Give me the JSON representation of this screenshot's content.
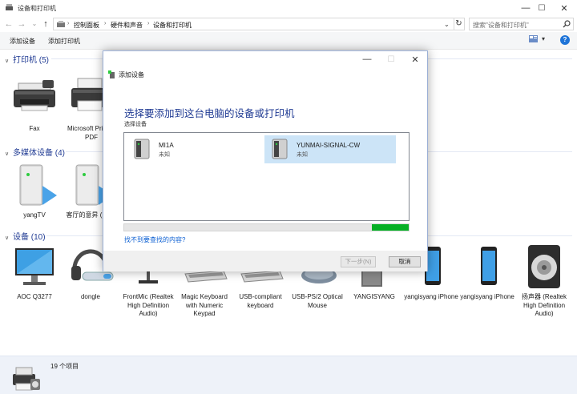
{
  "window": {
    "title": "设备和打印机",
    "controls": {
      "minimize": "—",
      "maximize": "☐",
      "close": "✕"
    }
  },
  "nav": {
    "back": "←",
    "forward": "→",
    "recent": "⌄",
    "up": "↑",
    "breadcrumb": [
      "控制面板",
      "硬件和声音",
      "设备和打印机"
    ],
    "separator": "›",
    "dropdown": "⌄",
    "refresh": "↻",
    "search_placeholder": "搜索\"设备和打印机\""
  },
  "toolbar": {
    "add_device": "添加设备",
    "add_printer": "添加打印机",
    "view_dropdown": "▾",
    "help": "?"
  },
  "sections": {
    "printers": {
      "title": "打印机 (5)",
      "items": [
        {
          "label": "Fax",
          "icon": "fax-icon"
        },
        {
          "label": "Microsoft Print to PDF",
          "icon": "printer-icon"
        }
      ]
    },
    "multimedia": {
      "title": "多媒体设备 (4)",
      "items": [
        {
          "label": "yangTV",
          "icon": "media-server-icon"
        },
        {
          "label": "客厅的意昇 (104)",
          "icon": "media-server-icon"
        }
      ]
    },
    "devices": {
      "title": "设备 (10)",
      "items": [
        {
          "label": "AOC Q3277",
          "icon": "monitor-icon"
        },
        {
          "label": "dongle",
          "icon": "headset-icon"
        },
        {
          "label": "FrontMic (Realtek High Definition Audio)",
          "icon": "microphone-icon"
        },
        {
          "label": "Magic Keyboard with Numeric Keypad",
          "icon": "keyboard-icon"
        },
        {
          "label": "USB-compliant keyboard",
          "icon": "keyboard-icon"
        },
        {
          "label": "USB-PS/2 Optical Mouse",
          "icon": "mouse-icon"
        },
        {
          "label": "YANGISYANG",
          "icon": "computer-icon"
        },
        {
          "label": "yangisyang iPhone",
          "icon": "phone-icon"
        },
        {
          "label": "yangisyang iPhone",
          "icon": "phone-icon"
        },
        {
          "label": "扬声器 (Realtek High Definition Audio)",
          "icon": "speaker-icon"
        }
      ]
    }
  },
  "statusbar": {
    "count": "19 个项目"
  },
  "dialog": {
    "window_title": "添加设备",
    "heading": "选择要添加到这台电脑的设备或打印机",
    "subheading": "选择设备",
    "devices": [
      {
        "name": "MI1A",
        "status": "未知",
        "selected": false
      },
      {
        "name": "YUNMAI-SIGNAL-CW",
        "status": "未知",
        "selected": true
      }
    ],
    "progress": 0.13,
    "help_link": "找不到要查找的内容?",
    "next_button": "下一步(N)",
    "cancel_button": "取消",
    "colors": {
      "accent": "#1f3a93",
      "progress": "#06b025",
      "selection": "#cce4f7"
    }
  }
}
